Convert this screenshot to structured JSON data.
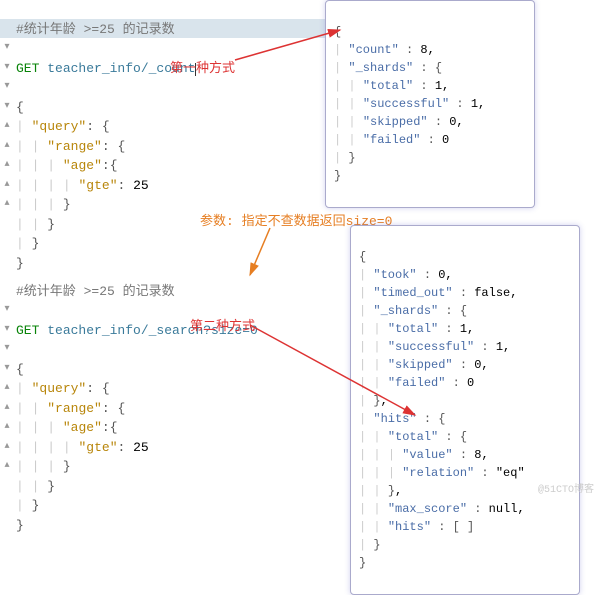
{
  "labels": {
    "method1": "第一种方式",
    "method2": "第二种方式",
    "param_note": "参数: 指定不查数据返回size=0"
  },
  "reqA": {
    "comment": "#统计年龄 >=25 的记录数",
    "method": "GET",
    "url": "teacher_info/_count",
    "body_lines": [
      "{",
      "  \"query\": {",
      "    \"range\": {",
      "      \"age\":{",
      "        \"gte\": 25",
      "      }",
      "    }",
      "  }",
      "}"
    ]
  },
  "reqB": {
    "comment": "#统计年龄 >=25 的记录数",
    "method": "GET",
    "url": "teacher_info/_search?size=0",
    "body_lines": [
      "{",
      "  \"query\": {",
      "    \"range\": {",
      "      \"age\":{",
      "        \"gte\": 25",
      "      }",
      "    }",
      "  }",
      "}"
    ]
  },
  "resA": {
    "lines": [
      "{",
      "  \"count\" : 8,",
      "  \"_shards\" : {",
      "    \"total\" : 1,",
      "    \"successful\" : 1,",
      "    \"skipped\" : 0,",
      "    \"failed\" : 0",
      "  }",
      "}"
    ]
  },
  "resB": {
    "lines": [
      "{",
      "  \"took\" : 0,",
      "  \"timed_out\" : false,",
      "  \"_shards\" : {",
      "    \"total\" : 1,",
      "    \"successful\" : 1,",
      "    \"skipped\" : 0,",
      "    \"failed\" : 0",
      "  },",
      "  \"hits\" : {",
      "    \"total\" : {",
      "      \"value\" : 8,",
      "      \"relation\" : \"eq\"",
      "    },",
      "    \"max_score\" : null,",
      "    \"hits\" : [ ]",
      "  }",
      "}"
    ]
  },
  "gutter_mark": "▾",
  "watermark": "@51CTO博客",
  "chart_data": null
}
